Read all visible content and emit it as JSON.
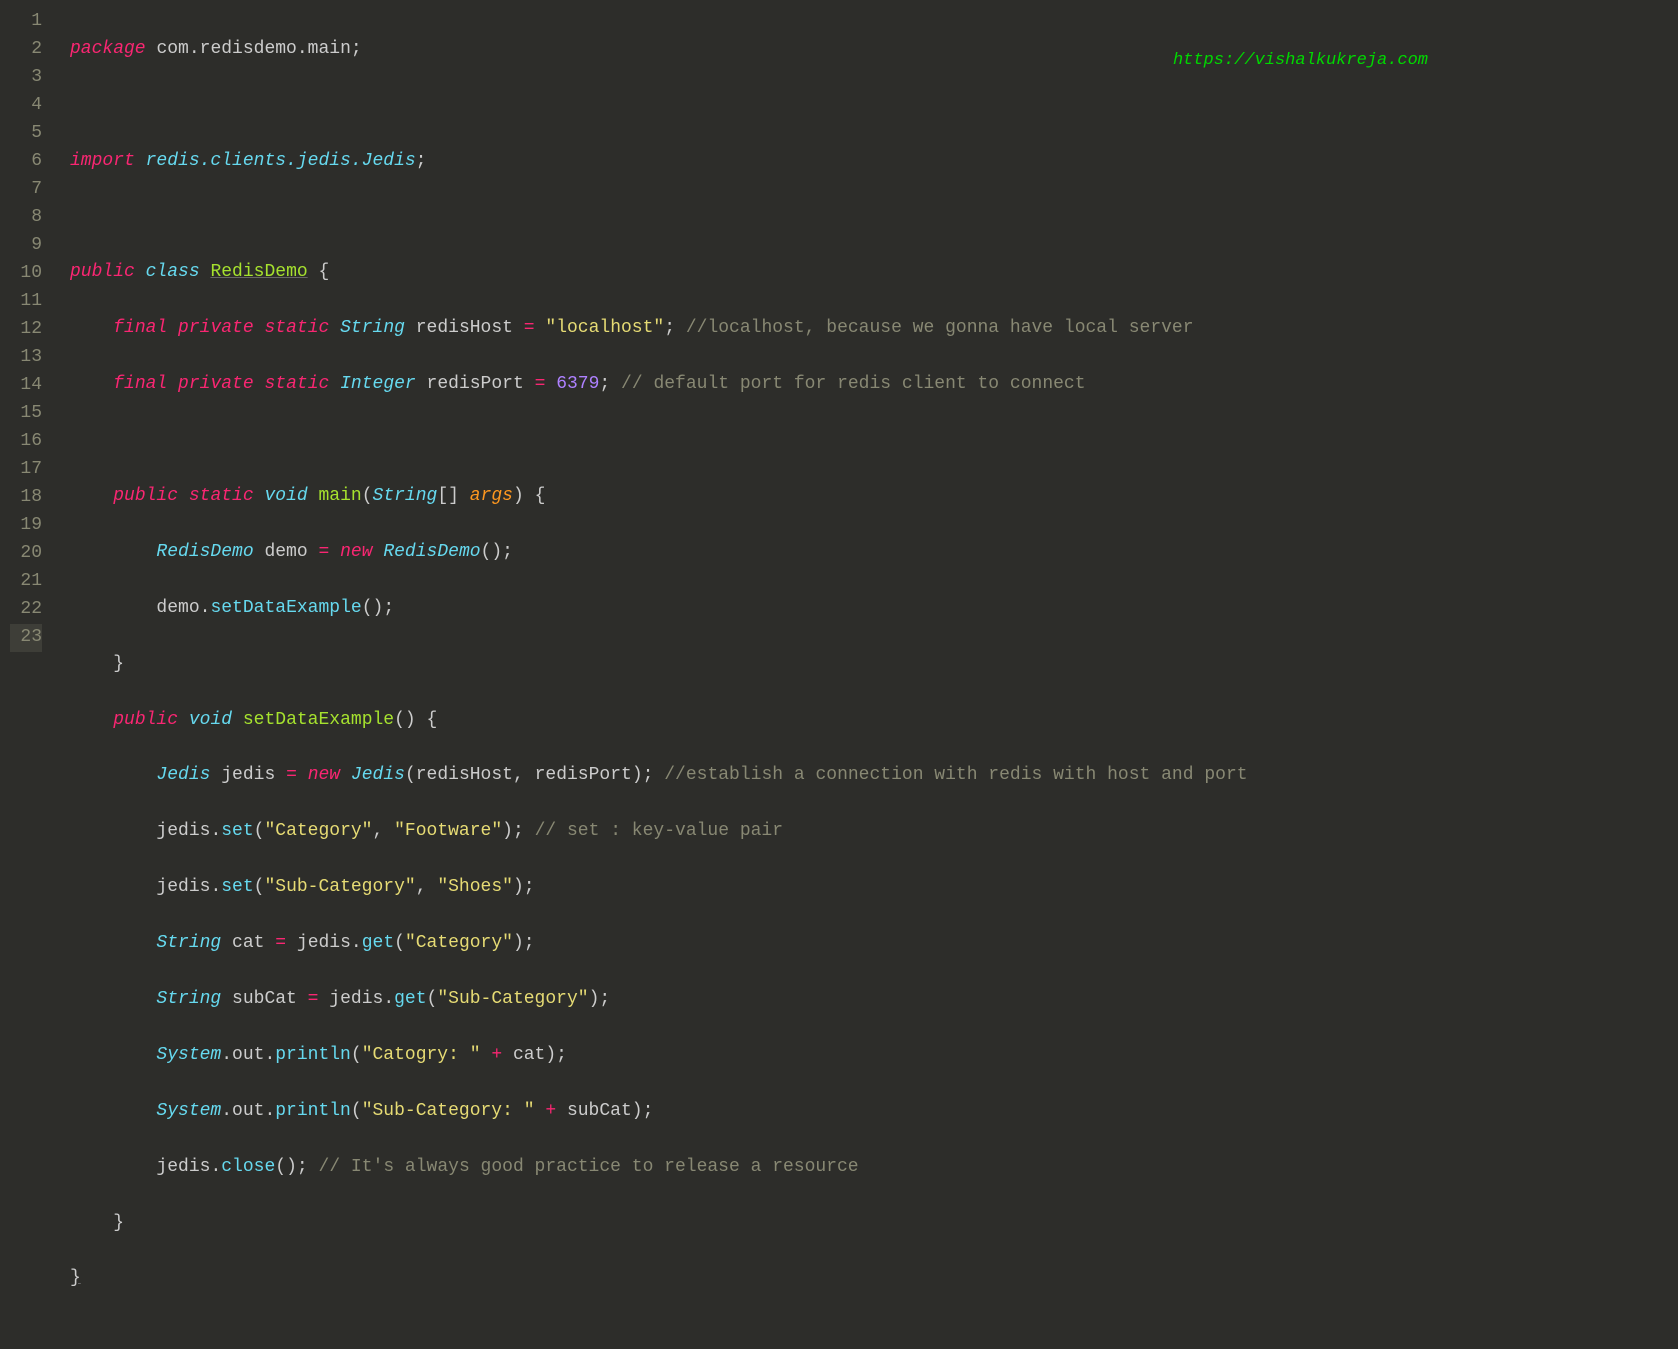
{
  "watermark": "https://vishalkukreja.com",
  "gutter": {
    "1": "1",
    "2": "2",
    "3": "3",
    "4": "4",
    "5": "5",
    "6": "6",
    "7": "7",
    "8": "8",
    "9": "9",
    "10": "10",
    "11": "11",
    "12": "12",
    "13": "13",
    "14": "14",
    "15": "15",
    "16": "16",
    "17": "17",
    "18": "18",
    "19": "19",
    "20": "20",
    "21": "21",
    "22": "22",
    "23": "23"
  },
  "tok": {
    "package": "package",
    "com_redisdemo_main": "com.redisdemo.main",
    "semi": ";",
    "import": "import",
    "redis_clients_jedis_Jedis": "redis.clients.jedis.Jedis",
    "public": "public",
    "class": "class",
    "RedisDemo": "RedisDemo",
    "ob": "{",
    "cb": "}",
    "final": "final",
    "private": "private",
    "static": "static",
    "String": "String",
    "Integer": "Integer",
    "redisHost": "redisHost",
    "redisPort": "redisPort",
    "eq": "=",
    "localhost": "\"localhost\"",
    "port": "6379",
    "c_localhost": "//localhost, because we gonna have local server",
    "c_port": "// default port for redis client to connect",
    "void": "void",
    "main": "main",
    "args": "args",
    "brackets": "[]",
    "op": "(",
    "cp": ")",
    "demo": "demo",
    "new": "new",
    "setDataExample": "setDataExample",
    "Jedis": "Jedis",
    "jedis": "jedis",
    "comma": ",",
    "c_establish": "//establish a connection with redis with host and port",
    "set": "set",
    "Category": "\"Category\"",
    "Footware": "\"Footware\"",
    "c_set": "// set : key-value pair",
    "SubCategory": "\"Sub-Category\"",
    "Shoes": "\"Shoes\"",
    "cat": "cat",
    "get": "get",
    "subCat": "subCat",
    "System": "System",
    "out": ".out.",
    "println": "println",
    "Catogry": "\"Catogry: \"",
    "plus": "+",
    "SubCategoryLbl": "\"Sub-Category: \"",
    "close": "close",
    "c_close": "// It's always good practice to release a resource",
    "dot": "."
  }
}
